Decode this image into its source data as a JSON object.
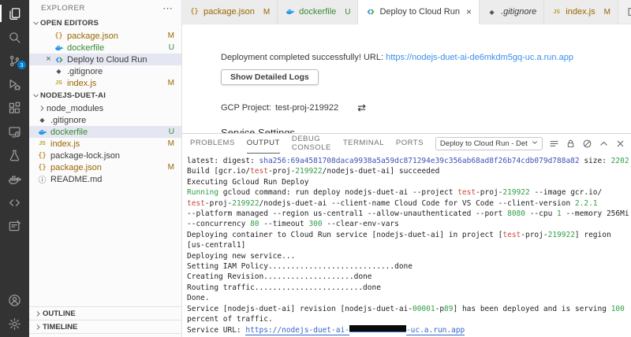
{
  "colors": {
    "accent": "#007acc",
    "modified": "#9a6700",
    "untracked": "#388a34",
    "log_blue": "#3f51b5",
    "log_green": "#2f9e44",
    "log_red": "#c9483a",
    "link_editor": "#3b8eea",
    "link_output": "#3366cc",
    "activitybar_bg": "#333333",
    "selection_bg": "#e4e6f1"
  },
  "activity_bar": {
    "top": [
      {
        "name": "explorer",
        "icon": "files",
        "active": true,
        "badge": ""
      },
      {
        "name": "search",
        "icon": "search",
        "active": false,
        "badge": ""
      },
      {
        "name": "source-control",
        "icon": "scm",
        "active": false,
        "badge": "3"
      },
      {
        "name": "run-debug",
        "icon": "debug",
        "active": false,
        "badge": ""
      },
      {
        "name": "extensions",
        "icon": "extensions",
        "active": false,
        "badge": ""
      },
      {
        "name": "remote-explorer",
        "icon": "remote",
        "active": false,
        "badge": ""
      },
      {
        "name": "testing",
        "icon": "beaker",
        "active": false,
        "badge": ""
      },
      {
        "name": "docker",
        "icon": "whale",
        "active": false,
        "badge": ""
      },
      {
        "name": "cloud-code",
        "icon": "cloudcode-mono",
        "active": false,
        "badge": ""
      },
      {
        "name": "duet-ai",
        "icon": "comment-edit",
        "active": false,
        "badge": ""
      }
    ],
    "bottom": [
      {
        "name": "account",
        "icon": "account",
        "active": false,
        "badge": ""
      },
      {
        "name": "settings",
        "icon": "gear",
        "active": false,
        "badge": ""
      }
    ]
  },
  "sidebar": {
    "title": "EXPLORER",
    "open_editors": {
      "label": "OPEN EDITORS",
      "items": [
        {
          "icon": "json",
          "label": "package.json",
          "badge": "M",
          "state": "modified",
          "selected": false,
          "close": false
        },
        {
          "icon": "docker",
          "label": "dockerfile",
          "badge": "U",
          "state": "untracked",
          "selected": false,
          "close": false
        },
        {
          "icon": "cloudcode",
          "label": "Deploy to Cloud Run",
          "badge": "",
          "state": "",
          "selected": true,
          "close": true
        },
        {
          "icon": "gitignore",
          "label": ".gitignore",
          "badge": "",
          "state": "",
          "selected": false,
          "close": false
        },
        {
          "icon": "js",
          "label": "index.js",
          "badge": "M",
          "state": "modified",
          "selected": false,
          "close": false
        }
      ]
    },
    "project": {
      "label": "NODEJS-DUET-AI",
      "items": [
        {
          "icon": "chev-right",
          "label": "node_modules",
          "badge": "",
          "state": "",
          "selected": false
        },
        {
          "icon": "gitignore",
          "label": ".gitignore",
          "badge": "",
          "state": "",
          "selected": false
        },
        {
          "icon": "docker",
          "label": "dockerfile",
          "badge": "U",
          "state": "untracked",
          "selected": true
        },
        {
          "icon": "js",
          "label": "index.js",
          "badge": "M",
          "state": "modified",
          "selected": false
        },
        {
          "icon": "json",
          "label": "package-lock.json",
          "badge": "",
          "state": "",
          "selected": false
        },
        {
          "icon": "json",
          "label": "package.json",
          "badge": "M",
          "state": "modified",
          "selected": false
        },
        {
          "icon": "readme",
          "label": "README.md",
          "badge": "",
          "state": "",
          "selected": false
        }
      ]
    },
    "bottom_sections": [
      {
        "label": "OUTLINE"
      },
      {
        "label": "TIMELINE"
      }
    ]
  },
  "tabs": [
    {
      "icon": "json",
      "label": "package.json",
      "badge": "M",
      "state": "modified",
      "active": false,
      "close": false,
      "italic": false
    },
    {
      "icon": "docker",
      "label": "dockerfile",
      "badge": "U",
      "state": "untracked",
      "active": false,
      "close": false,
      "italic": false
    },
    {
      "icon": "cloudcode",
      "label": "Deploy to Cloud Run",
      "badge": "",
      "state": "",
      "active": true,
      "close": true,
      "italic": false
    },
    {
      "icon": "gitignore",
      "label": ".gitignore",
      "badge": "",
      "state": "",
      "active": false,
      "close": false,
      "italic": true
    },
    {
      "icon": "js",
      "label": "index.js",
      "badge": "M",
      "state": "modified",
      "active": false,
      "close": false,
      "italic": false
    }
  ],
  "editor": {
    "status_text": "Deployment completed successfully! URL: ",
    "status_url": "https://nodejs-duet-ai-de6mkdm5gq-uc.a.run.app",
    "button_label": "Show Detailed Logs",
    "gcp_label": "GCP Project:",
    "gcp_value": "test-proj-219922",
    "swap_icon": "⇄",
    "heading": "Service Settings"
  },
  "panel": {
    "tabs": [
      {
        "label": "PROBLEMS",
        "active": false
      },
      {
        "label": "OUTPUT",
        "active": true
      },
      {
        "label": "DEBUG CONSOLE",
        "active": false
      },
      {
        "label": "TERMINAL",
        "active": false
      },
      {
        "label": "PORTS",
        "active": false
      }
    ],
    "channel": "Deploy to Cloud Run - Det",
    "actions": [
      {
        "name": "output-filter",
        "icon": "lines"
      },
      {
        "name": "lock-scroll",
        "icon": "lock"
      },
      {
        "name": "clear-output",
        "icon": "clear"
      },
      {
        "name": "maximize-panel",
        "icon": "chevron-up"
      },
      {
        "name": "close-panel",
        "icon": "close"
      }
    ],
    "output_lines": [
      [
        [
          "latest: digest: ",
          "d"
        ],
        [
          "sha256:69a4581708daca9938a5a59dc871294e39c356ab68ad8f26b74cdb079d788a82",
          "b"
        ],
        [
          " size: ",
          "d"
        ],
        [
          "2202",
          "g"
        ]
      ],
      [
        [
          "Build [gcr.io/",
          "d"
        ],
        [
          "test",
          "r"
        ],
        [
          "-proj-",
          "d"
        ],
        [
          "219922",
          "g"
        ],
        [
          "/nodejs-duet-ai] succeeded",
          "d"
        ]
      ],
      [
        [
          "Executing Gcloud Run Deploy",
          "d"
        ]
      ],
      [
        [
          "Running",
          "g"
        ],
        [
          " gcloud command: run deploy nodejs-duet-ai --project ",
          "d"
        ],
        [
          "test",
          "r"
        ],
        [
          "-proj-",
          "d"
        ],
        [
          "219922",
          "g"
        ],
        [
          " --image gcr.io/",
          "d"
        ]
      ],
      [
        [
          "test",
          "r"
        ],
        [
          "-proj-",
          "d"
        ],
        [
          "219922",
          "g"
        ],
        [
          "/nodejs-duet-ai --client-name Cloud Code for VS Code --client-version ",
          "d"
        ],
        [
          "2.2.1",
          "g"
        ]
      ],
      [
        [
          "--platform managed --region us-central1 --allow-unauthenticated --port ",
          "d"
        ],
        [
          "8080",
          "g"
        ],
        [
          " --cpu ",
          "d"
        ],
        [
          "1",
          "g"
        ],
        [
          " --memory 256Mi",
          "d"
        ]
      ],
      [
        [
          "--concurrency ",
          "d"
        ],
        [
          "80",
          "g"
        ],
        [
          " --timeout ",
          "d"
        ],
        [
          "300",
          "g"
        ],
        [
          " --clear-env-vars",
          "d"
        ]
      ],
      [
        [
          "Deploying container to Cloud Run service [nodejs-duet-ai] in project [",
          "d"
        ],
        [
          "test",
          "r"
        ],
        [
          "-proj-",
          "d"
        ],
        [
          "219922",
          "g"
        ],
        [
          "] region",
          "d"
        ]
      ],
      [
        [
          "[us-central1]",
          "d"
        ]
      ],
      [
        [
          "Deploying new service...",
          "d"
        ]
      ],
      [
        [
          "Setting IAM Policy............................done",
          "d"
        ]
      ],
      [
        [
          "Creating Revision....................done",
          "d"
        ]
      ],
      [
        [
          "Routing traffic........................done",
          "d"
        ]
      ],
      [
        [
          "Done.",
          "d"
        ]
      ],
      [
        [
          "Service [nodejs-duet-ai] revision [nodejs-duet-ai-",
          "d"
        ],
        [
          "00001",
          "g"
        ],
        [
          "-p",
          "d"
        ],
        [
          "89",
          "g"
        ],
        [
          "] has been deployed and is serving ",
          "d"
        ],
        [
          "100",
          "g"
        ]
      ],
      [
        [
          "percent of traffic.",
          "d"
        ]
      ],
      [
        [
          "Service URL: ",
          "d"
        ],
        [
          "https://nodejs-duet-ai-",
          "lnk"
        ],
        [
          "",
          "redact"
        ],
        [
          "-uc.a.run.app",
          "lnk"
        ]
      ]
    ]
  }
}
